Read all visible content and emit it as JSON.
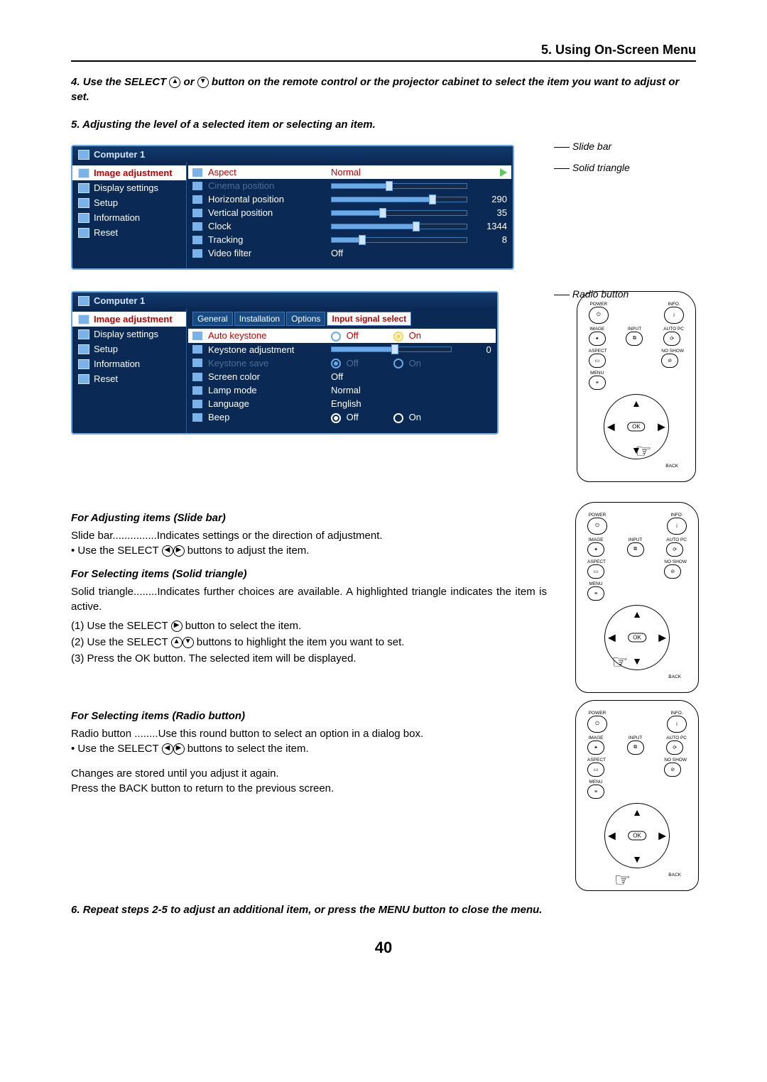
{
  "header": {
    "title": "5. Using On-Screen Menu"
  },
  "step4": {
    "num": "4.",
    "text_before": "Use the SELECT ",
    "sym1": "▲",
    "mid": " or ",
    "sym2": "▼",
    "text_after": " button on the remote control or the projector cabinet to select the item you want to adjust or set."
  },
  "step5": {
    "num": "5.",
    "text": "Adjusting the level of a selected item or selecting an item."
  },
  "callouts": {
    "slide_bar": "Slide bar",
    "solid_triangle": "Solid triangle",
    "radio_button": "Radio button"
  },
  "osd1": {
    "title": "Computer 1",
    "side": [
      "Image adjustment",
      "Display settings",
      "Setup",
      "Information",
      "Reset"
    ],
    "side_selected_index": 0,
    "rows": [
      {
        "label": "Aspect",
        "value": "Normal",
        "type": "triangle",
        "selected": true
      },
      {
        "label": "Cinema position",
        "type": "slider",
        "disabled": true,
        "num": ""
      },
      {
        "label": "Horizontal position",
        "type": "slider",
        "num": "290",
        "fill": 72
      },
      {
        "label": "Vertical position",
        "type": "slider",
        "num": "35",
        "fill": 35
      },
      {
        "label": "Clock",
        "type": "slider",
        "num": "1344",
        "fill": 60
      },
      {
        "label": "Tracking",
        "type": "slider",
        "num": "8",
        "fill": 20
      },
      {
        "label": "Video filter",
        "value": "Off",
        "type": "text"
      }
    ]
  },
  "osd2": {
    "title": "Computer 1",
    "side": [
      "Image adjustment",
      "Display settings",
      "Setup",
      "Information",
      "Reset"
    ],
    "side_selected_index": 0,
    "tabs": [
      "General",
      "Installation",
      "Options",
      "Input signal select"
    ],
    "tab_selected_index": 3,
    "rows": [
      {
        "label": "Auto keystone",
        "type": "radio",
        "off": "Off",
        "on": "On",
        "sel": "on",
        "selected": true
      },
      {
        "label": "Keystone adjustment",
        "type": "slider",
        "num": "0",
        "fill": 50
      },
      {
        "label": "Keystone save",
        "type": "radio",
        "off": "Off",
        "on": "On",
        "sel": "off",
        "disabled": true
      },
      {
        "label": "Screen color",
        "value": "Off",
        "type": "text"
      },
      {
        "label": "Lamp mode",
        "value": "Normal",
        "type": "text"
      },
      {
        "label": "Language",
        "value": "English",
        "type": "text"
      },
      {
        "label": "Beep",
        "type": "radio",
        "off": "Off",
        "on": "On",
        "sel": "off",
        "dotstyle": true
      }
    ]
  },
  "remote": {
    "power": "POWER",
    "info": "INFO.",
    "image": "IMAGE",
    "input": "INPUT",
    "autopc": "AUTO PC",
    "aspect": "ASPECT",
    "noshow": "NO SHOW",
    "menu": "MENU",
    "ok": "OK",
    "back": "BACK"
  },
  "section_slidebar": {
    "head": "For Adjusting items (Slide bar)",
    "line1": "Slide bar...............Indicates settings or the direction of adjustment.",
    "line2_pre": "• Use the SELECT ",
    "line2_post": " buttons to adjust the item."
  },
  "section_triangle": {
    "head": "For Selecting items (Solid triangle)",
    "intro": "Solid triangle........Indicates further choices are available. A highlighted triangle indicates the item is active.",
    "l1_pre": "(1)  Use the SELECT ",
    "l1_post": " button to select the item.",
    "l2_pre": "(2)  Use the SELECT ",
    "l2_post": " buttons to highlight the item you want to set.",
    "l3": "(3)  Press the OK button. The selected item will be displayed."
  },
  "section_radio": {
    "head": "For Selecting items (Radio button)",
    "intro": "Radio button ........Use this round button to select an option in a dialog box.",
    "line_pre": "• Use the SELECT ",
    "line_post": " buttons to select the item.",
    "note1": "Changes are stored until you adjust it again.",
    "note2": "Press the BACK button to return to the previous screen."
  },
  "step6": {
    "num": "6.",
    "text": "Repeat steps 2-5 to adjust an additional item, or press the MENU button to close the menu."
  },
  "page_number": "40"
}
